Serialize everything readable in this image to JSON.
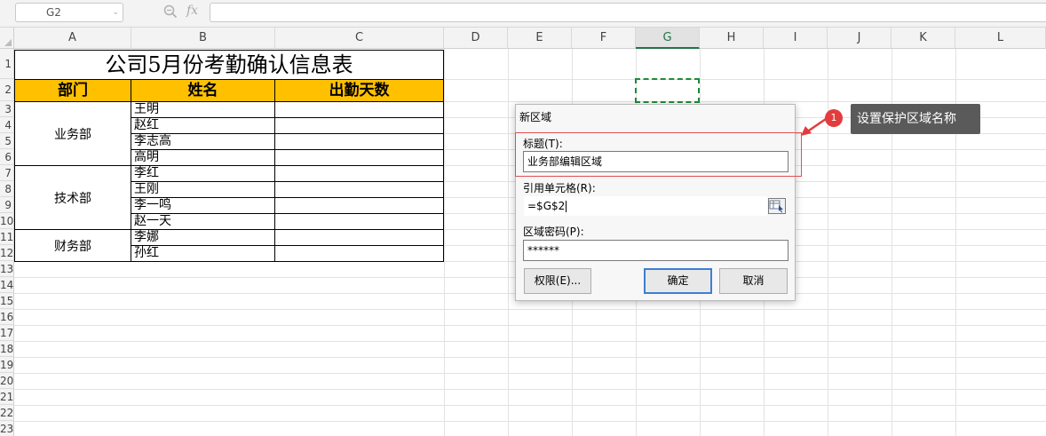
{
  "formula_bar": {
    "name_box": "G2",
    "fx": "fx",
    "zoom_icon": "zoom-icon",
    "value": ""
  },
  "columns": [
    "A",
    "B",
    "C",
    "D",
    "E",
    "F",
    "G",
    "H",
    "I",
    "J",
    "K",
    "L"
  ],
  "selected_column": "G",
  "rows": [
    "1",
    "2",
    "3",
    "4",
    "5",
    "6",
    "7",
    "8",
    "9",
    "10",
    "11",
    "12",
    "13",
    "14",
    "15",
    "16",
    "17",
    "18",
    "19",
    "20",
    "21",
    "22",
    "23"
  ],
  "table": {
    "title": "公司5月份考勤确认信息表",
    "headers": [
      "部门",
      "姓名",
      "出勤天数"
    ],
    "header_color": "#ffc000",
    "groups": [
      {
        "dept": "业务部",
        "names": [
          "王明",
          "赵红",
          "李志高",
          "高明"
        ]
      },
      {
        "dept": "技术部",
        "names": [
          "李红",
          "王刚",
          "李一鸣",
          "赵一天"
        ]
      },
      {
        "dept": "财务部",
        "names": [
          "李娜",
          "孙红"
        ]
      }
    ]
  },
  "dialog": {
    "title": "新区域",
    "title_label": "标题(T):",
    "title_value": "业务部编辑区域",
    "ref_label": "引用单元格(R):",
    "ref_value": "=$G$2",
    "password_label": "区域密码(P):",
    "password_value": "******",
    "permissions_button": "权限(E)...",
    "ok_button": "确定",
    "cancel_button": "取消"
  },
  "annotation": {
    "badge": "1",
    "callout": "设置保护区域名称",
    "color": "#e23c3c"
  }
}
